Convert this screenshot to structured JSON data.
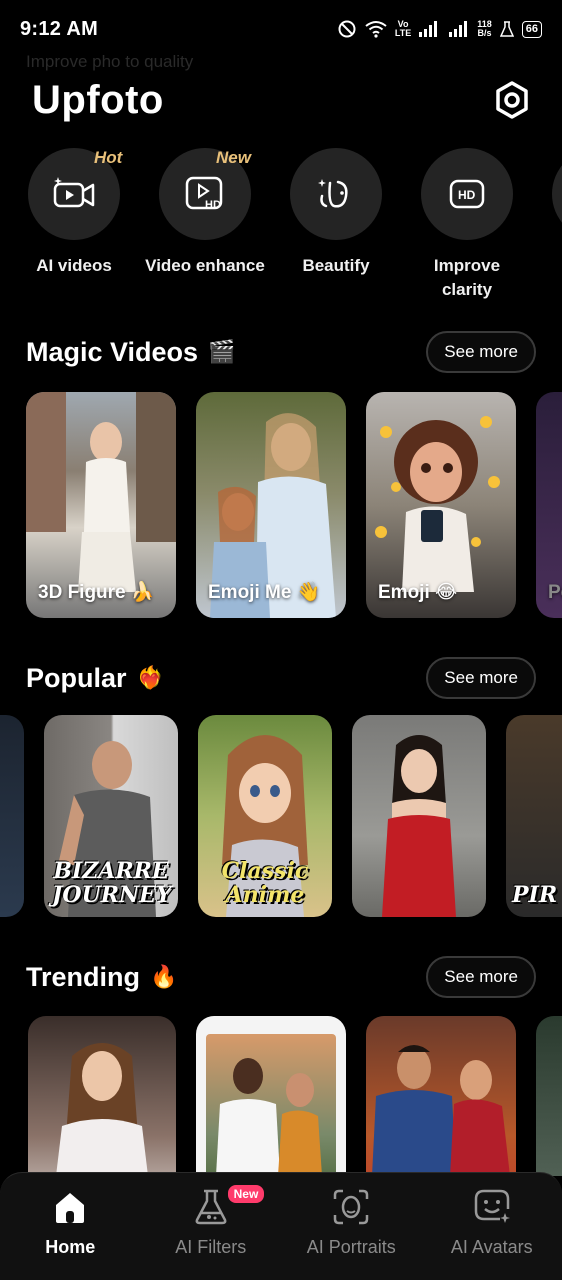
{
  "status": {
    "time": "9:12 AM",
    "network_type": "LTE",
    "network_label": "Vo",
    "speed_value": "118",
    "speed_unit": "B/s",
    "battery": "66"
  },
  "banner_text": "Improve pho to quality",
  "app": {
    "title": "Upfoto"
  },
  "tools": [
    {
      "label": "AI videos",
      "tag": "Hot",
      "icon": "video-camera-icon"
    },
    {
      "label": "Video enhance",
      "tag": "New",
      "icon": "hd-video-icon"
    },
    {
      "label": "Beautify",
      "tag": "",
      "icon": "face-sparkle-icon"
    },
    {
      "label": "Improve clarity",
      "tag": "",
      "icon": "hd-icon"
    }
  ],
  "sections": {
    "magic": {
      "title": "Magic Videos",
      "emoji": "🎬",
      "see_more": "See more",
      "cards": [
        {
          "label": "3D Figure 🍌"
        },
        {
          "label": "Emoji Me 👋"
        },
        {
          "label": "Emoji 😂"
        },
        {
          "label": "Pe"
        }
      ]
    },
    "popular": {
      "title": "Popular",
      "emoji": "❤️‍🔥",
      "see_more": "See more",
      "cards": [
        {
          "label": ""
        },
        {
          "label": "BIZARRE JOURNEY"
        },
        {
          "label": "Classic Anime"
        },
        {
          "label": ""
        },
        {
          "label": "PIR"
        }
      ]
    },
    "trending": {
      "title": "Trending",
      "emoji": "🔥",
      "see_more": "See more"
    }
  },
  "nav": {
    "items": [
      {
        "label": "Home",
        "icon": "home-icon"
      },
      {
        "label": "AI Filters",
        "icon": "flask-icon",
        "badge": "New"
      },
      {
        "label": "AI Portraits",
        "icon": "face-scan-icon"
      },
      {
        "label": "AI Avatars",
        "icon": "smiley-sparkle-icon"
      }
    ]
  },
  "colors": {
    "accent_tag": "#e8c07a",
    "badge": "#ff3b6b",
    "background": "#000000"
  }
}
